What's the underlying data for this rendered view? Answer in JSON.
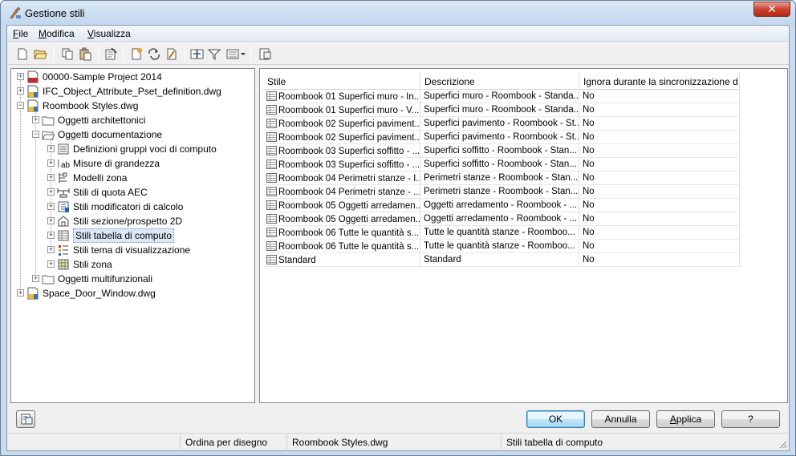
{
  "window": {
    "title": "Gestione stili",
    "close_label": "✕"
  },
  "menubar": {
    "items": [
      {
        "label": "File",
        "mnemonic": "F",
        "rest": "ile"
      },
      {
        "label": "Modifica",
        "mnemonic": "M",
        "rest": "odifica"
      },
      {
        "label": "Visualizza",
        "mnemonic": "V",
        "rest": "isualizza"
      }
    ]
  },
  "toolbar": {
    "icons": [
      "new-icon",
      "open-icon",
      "copy-icon",
      "paste-icon",
      "purge-icon",
      "new-style-icon",
      "synchronize-icon",
      "edit-style-icon",
      "copy-to-drawing-icon",
      "filter-icon",
      "view-mode-icon",
      "toggle-view-icon"
    ]
  },
  "tree": {
    "nodes": [
      {
        "label": "00000-Sample Project 2014",
        "icon": "project-icon",
        "expander": "+"
      },
      {
        "label": "IFC_Object_Attribute_Pset_definition.dwg",
        "icon": "dwg-icon",
        "expander": "+"
      },
      {
        "label": "Roombook Styles.dwg",
        "icon": "dwg-icon",
        "expander": "−"
      },
      {
        "label": "Oggetti architettonici",
        "icon": "folder-icon",
        "expander": "+"
      },
      {
        "label": "Oggetti documentazione",
        "icon": "folder-open-icon",
        "expander": "−"
      },
      {
        "label": "Definizioni gruppi voci di computo",
        "icon": "list-definition-icon",
        "expander": "+"
      },
      {
        "label": "Misure di grandezza",
        "icon": "label-ab-icon",
        "expander": "+"
      },
      {
        "label": "Modelli zona",
        "icon": "zone-template-icon",
        "expander": "+"
      },
      {
        "label": "Stili di quota AEC",
        "icon": "dimension-icon",
        "expander": "+"
      },
      {
        "label": "Stili modificatori di calcolo",
        "icon": "calculation-modifier-icon",
        "expander": "+"
      },
      {
        "label": "Stili sezione/prospetto 2D",
        "icon": "section-elevation-icon",
        "expander": "+"
      },
      {
        "label": "Stili tabella di computo",
        "icon": "schedule-table-icon",
        "expander": "+",
        "selected": true
      },
      {
        "label": "Stili tema di visualizzazione",
        "icon": "display-theme-icon",
        "expander": "+"
      },
      {
        "label": "Stili zona",
        "icon": "zone-style-icon",
        "expander": "+"
      },
      {
        "label": "Oggetti multifunzionali",
        "icon": "folder-icon",
        "expander": "+"
      },
      {
        "label": "Space_Door_Window.dwg",
        "icon": "dwg-icon",
        "expander": "+"
      }
    ]
  },
  "list": {
    "columns": [
      "Stile",
      "Descrizione",
      "Ignora durante la sincronizzazione d..."
    ],
    "rows": [
      [
        "Roombook 01 Superfici muro - In...",
        "Superfici muro - Roombook - Standa...",
        "No"
      ],
      [
        "Roombook 01 Superfici muro - V...",
        "Superfici muro - Roombook - Standa...",
        "No"
      ],
      [
        "Roombook 02 Superfici paviment...",
        "Superfici pavimento - Roombook - St...",
        "No"
      ],
      [
        "Roombook 02 Superfici paviment...",
        "Superfici pavimento - Roombook - St...",
        "No"
      ],
      [
        "Roombook 03 Superfici soffitto - ...",
        "Superfici soffitto - Roombook - Stan...",
        "No"
      ],
      [
        "Roombook 03 Superfici soffitto - ...",
        "Superfici soffitto - Roombook - Stan...",
        "No"
      ],
      [
        "Roombook 04 Perimetri stanze - I...",
        "Perimetri stanze - Roombook - Stan...",
        "No"
      ],
      [
        "Roombook 04 Perimetri stanze - ...",
        "Perimetri stanze - Roombook - Stan...",
        "No"
      ],
      [
        "Roombook 05 Oggetti arredamen...",
        "Oggetti arredamento - Roombook - ...",
        "No"
      ],
      [
        "Roombook 05 Oggetti arredamen...",
        "Oggetti arredamento - Roombook - ...",
        "No"
      ],
      [
        "Roombook 06 Tutte le quantità s...",
        "Tutte le quantità stanze - Roomboo...",
        "No"
      ],
      [
        "Roombook 06 Tutte le quantità s...",
        "Tutte le quantità stanze - Roomboo...",
        "No"
      ],
      [
        "Standard",
        "Standard",
        "No"
      ]
    ]
  },
  "buttons": {
    "ok": "OK",
    "cancel": "Annulla",
    "apply_mnemonic": "A",
    "apply_rest": "pplica",
    "help": "?"
  },
  "statusbar": {
    "sort": "Ordina per disegno",
    "drawing": "Roombook Styles.dwg",
    "category": "Stili tabella di computo"
  }
}
